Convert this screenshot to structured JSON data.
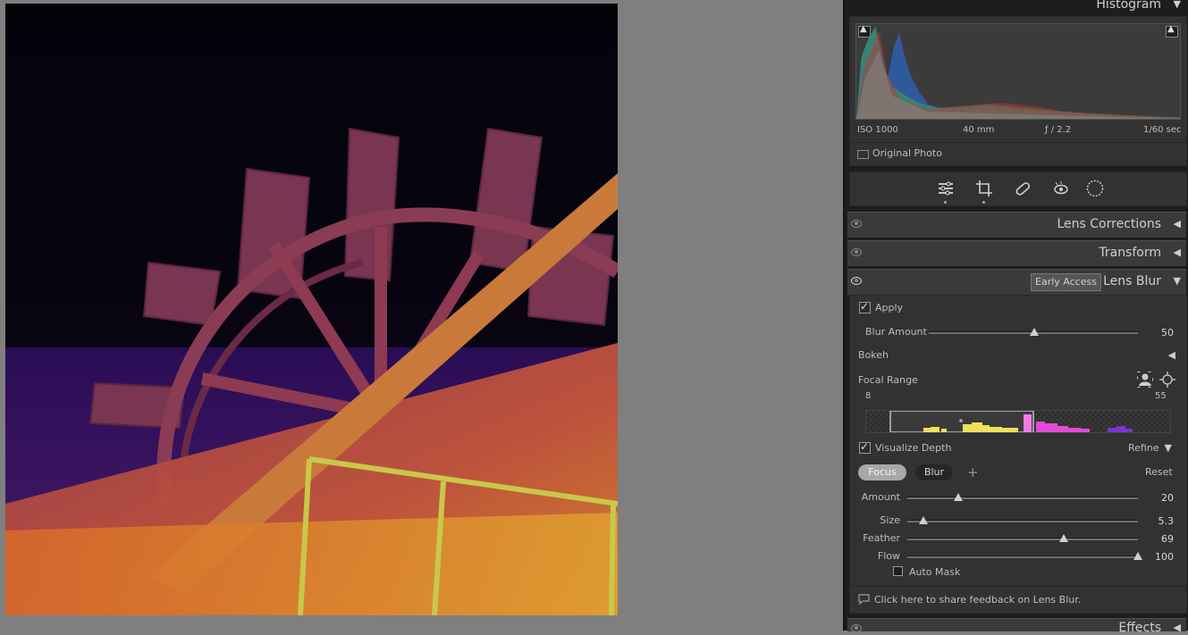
{
  "histogram": {
    "title": "Histogram",
    "iso": "ISO 1000",
    "focal": "40 mm",
    "aperture": "ƒ / 2.2",
    "shutter": "1/60 sec",
    "original_photo_label": "Original Photo"
  },
  "toolbar": {
    "tools": [
      "edit-icon",
      "crop-icon",
      "healing-icon",
      "redeye-icon",
      "masking-icon"
    ]
  },
  "panels": {
    "lens_corrections": "Lens Corrections",
    "transform": "Transform",
    "lens_blur": "Lens Blur",
    "early_access": "Early Access",
    "effects": "Effects"
  },
  "lens_blur": {
    "apply_label": "Apply",
    "apply_checked": true,
    "blur_amount_label": "Blur Amount",
    "blur_amount_value": "50",
    "bokeh_label": "Bokeh",
    "focal_range_label": "Focal Range",
    "range_min": "8",
    "range_max": "55",
    "visualize_depth_label": "Visualize Depth",
    "visualize_depth_checked": true,
    "refine_label": "Refine",
    "focus_label": "Focus",
    "blur_label": "Blur",
    "add_label": "+",
    "reset_label": "Reset",
    "sliders": [
      {
        "label": "Amount",
        "value": "20",
        "fraction": 0.22
      },
      {
        "label": "Size",
        "value": "5.3",
        "fraction": 0.07
      },
      {
        "label": "Feather",
        "value": "69",
        "fraction": 0.68
      },
      {
        "label": "Flow",
        "value": "100",
        "fraction": 1.0
      }
    ],
    "auto_mask_label": "Auto Mask",
    "auto_mask_checked": false,
    "feedback_label": "Click here to share feedback on Lens Blur."
  },
  "colors": {
    "panel_bg": "#1d1d1d",
    "section_bg": "#323232",
    "accent_pink": "#e24bd6",
    "accent_yellow": "#f0d040"
  }
}
